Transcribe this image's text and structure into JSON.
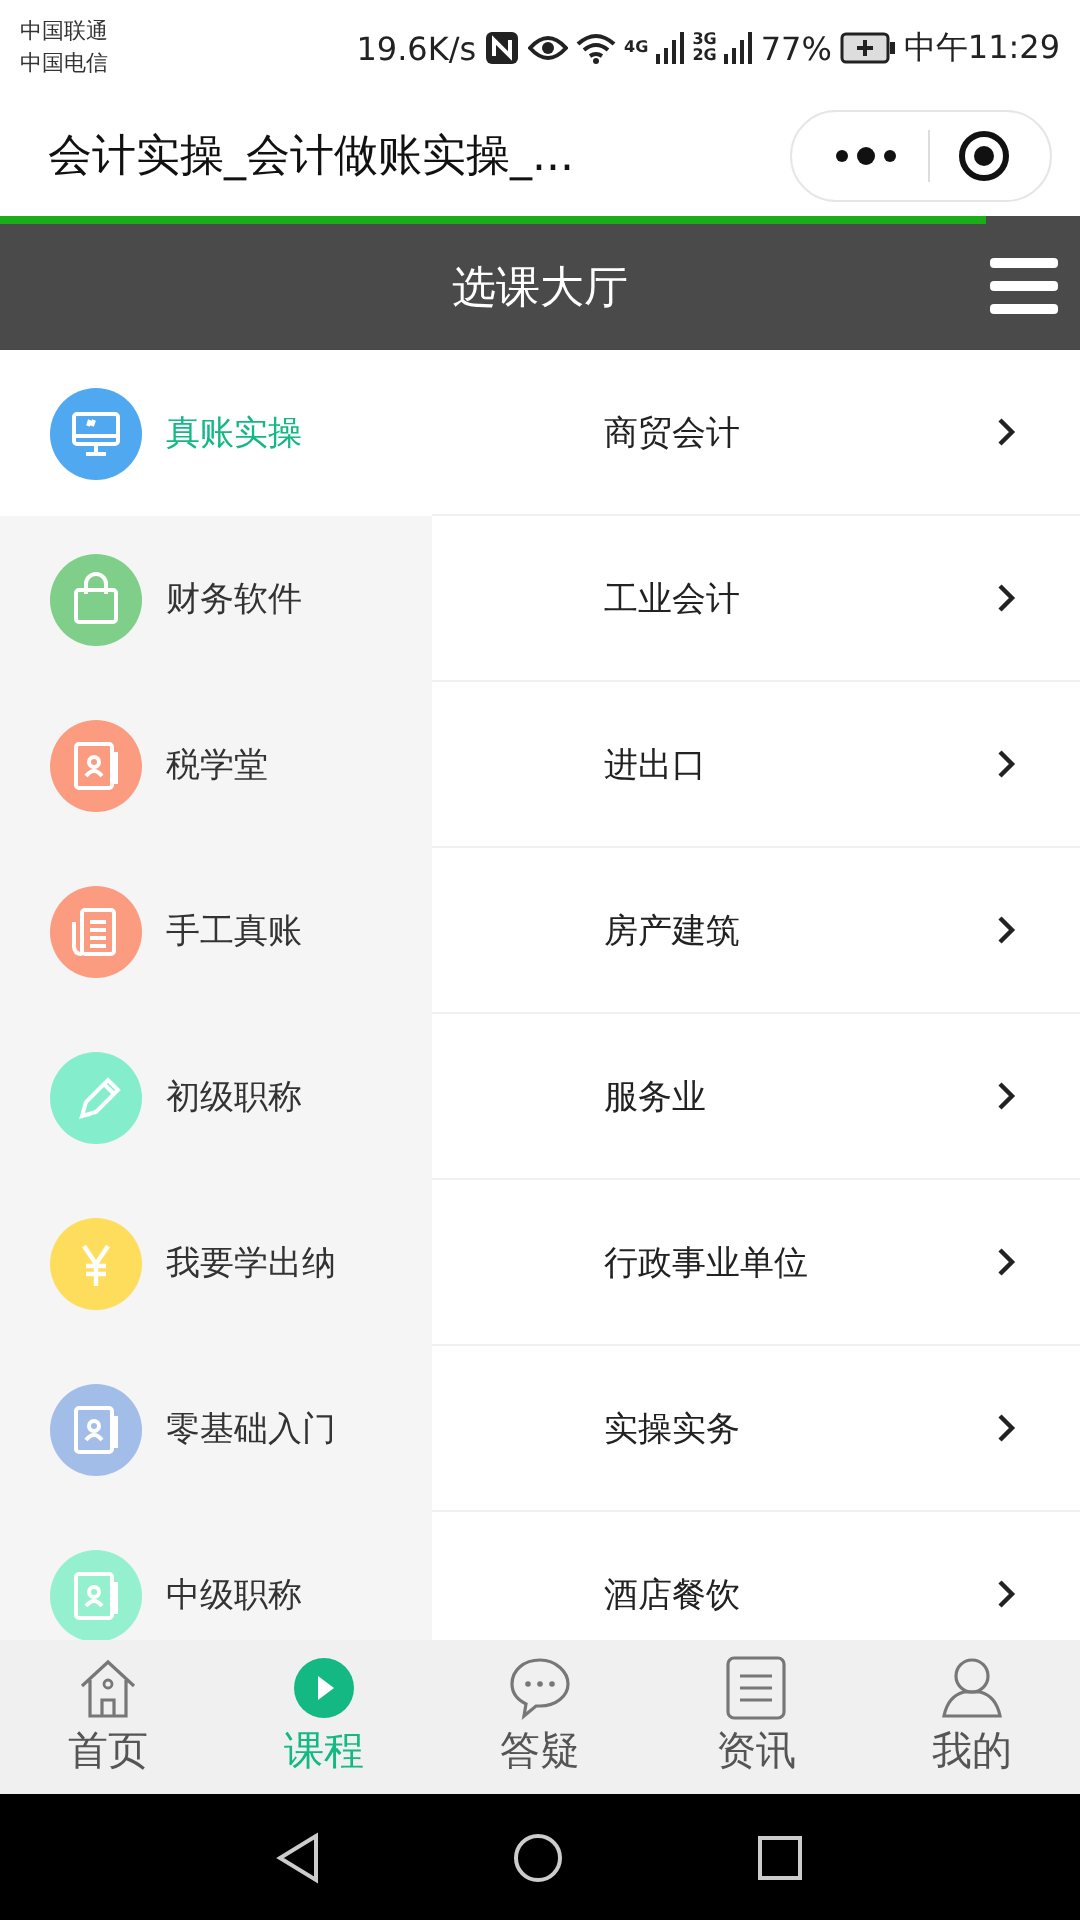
{
  "status_bar": {
    "carriers": [
      "中国联通",
      "中国电信"
    ],
    "speed": "19.6K/s",
    "network_4g": "4G",
    "network_3g": "3G",
    "network_2g": "2G",
    "battery": "77%",
    "time": "中午11:29"
  },
  "title_bar": {
    "title": "会计实操_会计做账实操_..."
  },
  "loading": {
    "level": 0.913
  },
  "header": {
    "title": "选课大厅"
  },
  "categories": [
    {
      "label": "真账实操",
      "kind": "monitor",
      "color": "#4fa8f0",
      "selected": true
    },
    {
      "label": "财务软件",
      "kind": "bag",
      "color": "#7fcf8a",
      "selected": false
    },
    {
      "label": "税学堂",
      "kind": "contact",
      "color": "#fb9c80",
      "selected": false
    },
    {
      "label": "手工真账",
      "kind": "ledger",
      "color": "#fb9c80",
      "selected": false
    },
    {
      "label": "初级职称",
      "kind": "pencil",
      "color": "#84edcc",
      "selected": false
    },
    {
      "label": "我要学出纳",
      "kind": "yen",
      "color": "#fedd5c",
      "selected": false
    },
    {
      "label": "零基础入门",
      "kind": "contact",
      "color": "#a2bee8",
      "selected": false
    },
    {
      "label": "中级职称",
      "kind": "contact",
      "color": "#95f0d0",
      "selected": false
    }
  ],
  "subcategories": [
    {
      "label": "商贸会计"
    },
    {
      "label": "工业会计"
    },
    {
      "label": "进出口"
    },
    {
      "label": "房产建筑"
    },
    {
      "label": "服务业"
    },
    {
      "label": "行政事业单位"
    },
    {
      "label": "实操实务"
    },
    {
      "label": "酒店餐饮"
    }
  ],
  "tabs": [
    {
      "label": "首页",
      "kind": "home",
      "selected": false
    },
    {
      "label": "课程",
      "kind": "play",
      "selected": true
    },
    {
      "label": "答疑",
      "kind": "chat",
      "selected": false
    },
    {
      "label": "资讯",
      "kind": "news",
      "selected": false
    },
    {
      "label": "我的",
      "kind": "user",
      "selected": false
    }
  ]
}
